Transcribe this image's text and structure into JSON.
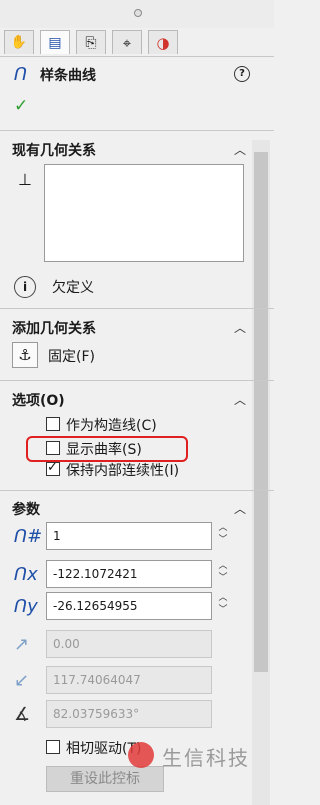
{
  "panel": {
    "title": "样条曲线",
    "help_icon": "?",
    "ok_icon": "✓"
  },
  "tabs": [
    {
      "name": "feature-manager-icon",
      "glyph": "✋"
    },
    {
      "name": "property-manager-icon",
      "glyph": "▤"
    },
    {
      "name": "configuration-manager-icon",
      "glyph": "⎘"
    },
    {
      "name": "dimxpert-icon",
      "glyph": "⌖"
    },
    {
      "name": "display-manager-icon",
      "glyph": "◑"
    }
  ],
  "existing_relations": {
    "header": "现有几何关系",
    "status_text": "欠定义",
    "info_icon": "i"
  },
  "add_relations": {
    "header": "添加几何关系",
    "fix_label": "固定(F)"
  },
  "options": {
    "header": "选项(O)",
    "construction": {
      "label": "作为构造线(C)",
      "checked": false
    },
    "show_curvature": {
      "label": "显示曲率(S)",
      "checked": false
    },
    "keep_continuity": {
      "label": "保持内部连续性(I)",
      "checked": true
    }
  },
  "parameters": {
    "header": "参数",
    "point_index": "1",
    "x_coord": "-122.1072421",
    "y_coord": "-26.12654955",
    "weight": "0.00",
    "radial_dir": "117.74064047",
    "tangent_angle": "82.03759633°",
    "tangent_drive": {
      "label": "相切驱动(T)",
      "checked": false
    },
    "reset_button": "重设此控标"
  },
  "watermark": "生信科技"
}
